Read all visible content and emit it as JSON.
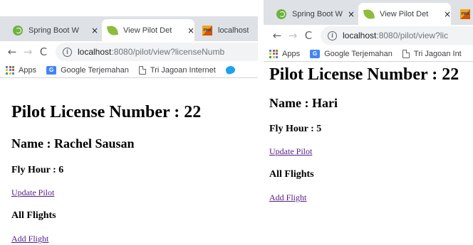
{
  "left": {
    "tabs": [
      {
        "label": "Spring Boot W",
        "favicon": "spring-icon",
        "active": false
      },
      {
        "label": "View Pilot Det",
        "favicon": "leaf-icon",
        "active": true
      },
      {
        "label": "localhost",
        "favicon": "pma-icon",
        "active": false
      }
    ],
    "address": {
      "host": "localhost",
      "path": ":8080/pilot/view?licenseNumb"
    },
    "bookmarks": [
      "Apps",
      "Google Terjemahan",
      "Tri Jagoan Internet"
    ],
    "page": {
      "license_heading": "Pilot License Number : 22",
      "name_heading": "Name : Rachel Sausan",
      "fly_hour": "Fly Hour : 6",
      "update_link": "Update Pilot",
      "flights_heading": "All Flights",
      "add_flight_link": "Add Flight"
    }
  },
  "right": {
    "tabs": [
      {
        "label": "Spring Boot W",
        "favicon": "spring-icon",
        "active": false
      },
      {
        "label": "View Pilot Det",
        "favicon": "leaf-icon",
        "active": true
      },
      {
        "label": "",
        "favicon": "pma-icon",
        "active": false
      }
    ],
    "address": {
      "host": "localhost",
      "path": ":8080/pilot/view?lic"
    },
    "bookmarks": [
      "Apps",
      "Google Terjemahan",
      "Tri Jagoan Int"
    ],
    "page": {
      "license_heading": "Pilot License Number : 22",
      "name_heading": "Name : Hari",
      "fly_hour": "Fly Hour : 5",
      "update_link": "Update Pilot",
      "flights_heading": "All Flights",
      "add_flight_link": "Add Flight"
    }
  },
  "icons": {
    "close": "×",
    "back": "←",
    "forward": "→",
    "reload": "C",
    "info": "i",
    "pma_text": "PMA",
    "translate_text": "G"
  }
}
